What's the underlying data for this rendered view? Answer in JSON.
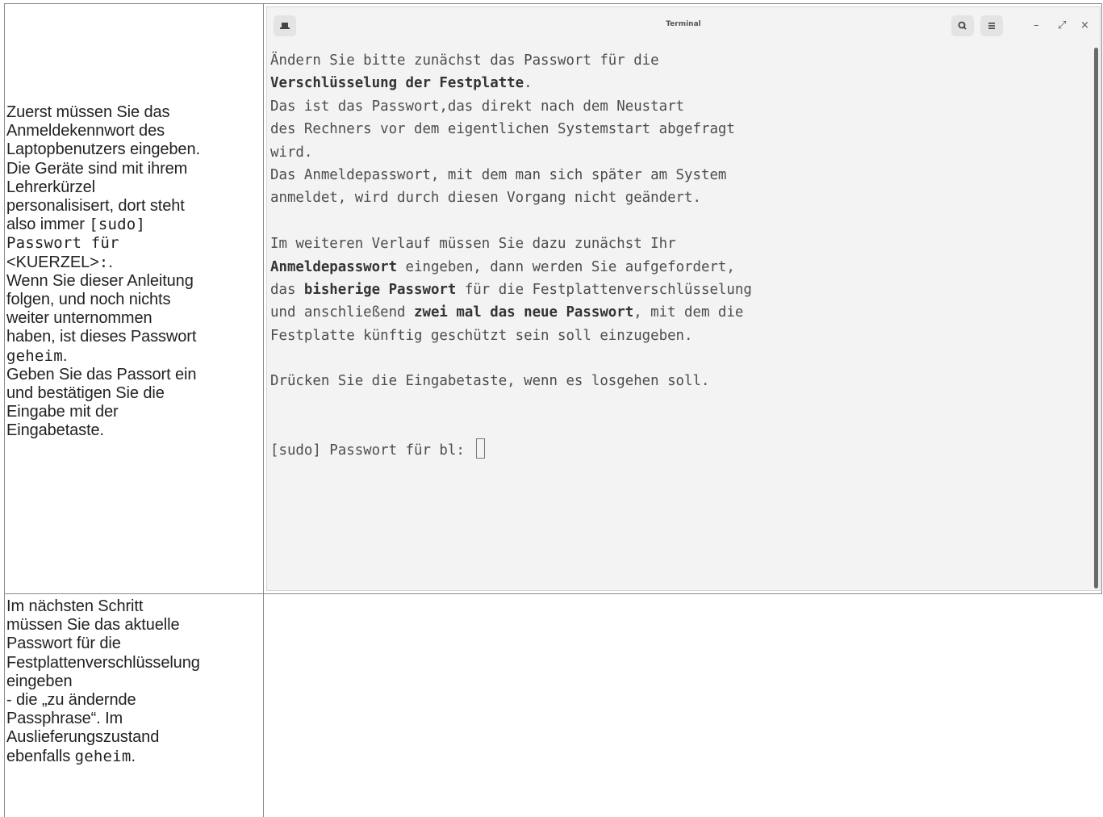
{
  "left_column": {
    "row1_lines": [
      {
        "text": "Zuerst müssen Sie das"
      },
      {
        "text": "Anmeldekennwort des"
      },
      {
        "text": "Laptopbenutzers eingeben."
      },
      {
        "text": "Die Geräte sind mit ihrem"
      },
      {
        "text": "Lehrerkürzel"
      },
      {
        "text": "personalisisert, dort steht"
      },
      {
        "pre": "also immer ",
        "code": "[sudo]"
      },
      {
        "code": "Passwort für"
      },
      {
        "pre": "<KUERZEL>",
        "code": ":",
        "post": "."
      },
      {
        "text": "Wenn Sie dieser Anleitung"
      },
      {
        "text": "folgen, und noch nichts"
      },
      {
        "text": "weiter unternommen"
      },
      {
        "text": "haben, ist dieses Passwort"
      },
      {
        "code": "geheim",
        "post": "."
      },
      {
        "text": "Geben Sie das Passort ein"
      },
      {
        "text": "und bestätigen Sie die"
      },
      {
        "text": "Eingabe mit der"
      },
      {
        "text": "Eingabetaste."
      }
    ],
    "row2_lines": [
      {
        "text": "Im nächsten Schritt"
      },
      {
        "text": "müssen Sie das aktuelle"
      },
      {
        "text": "Passwort für die"
      },
      {
        "text": "Festplattenverschlüsselung"
      },
      {
        "text": "eingeben"
      },
      {
        "text": "- die „zu ändernde"
      },
      {
        "text": "Passphrase“. Im"
      },
      {
        "text": "Auslieferungszustand"
      },
      {
        "pre": "ebenfalls ",
        "code": "geheim",
        "post": "."
      }
    ]
  },
  "terminal": {
    "title": "Terminal",
    "icons": {
      "new_tab": "new-tab-icon",
      "search": "search-icon",
      "menu": "menu-icon",
      "minimize": "minimize-icon",
      "maximize": "maximize-icon",
      "close": "close-icon"
    },
    "glyphs": {
      "minimize": "–",
      "maximize": "⤢",
      "close": "×"
    },
    "lines": [
      [
        {
          "t": "Ändern Sie bitte zunächst das Passwort für die"
        }
      ],
      [
        {
          "t": "Verschlüsselung der Festplatte",
          "b": true
        },
        {
          "t": "."
        }
      ],
      [
        {
          "t": "Das ist das Passwort,das direkt nach dem Neustart"
        }
      ],
      [
        {
          "t": "des Rechners vor dem eigentlichen Systemstart abgefragt"
        }
      ],
      [
        {
          "t": "wird."
        }
      ],
      [
        {
          "t": "Das Anmeldepasswort, mit dem man sich später am System"
        }
      ],
      [
        {
          "t": "anmeldet, wird durch diesen Vorgang nicht geändert."
        }
      ],
      [
        {
          "t": ""
        }
      ],
      [
        {
          "t": "Im weiteren Verlauf müssen Sie dazu zunächst Ihr"
        }
      ],
      [
        {
          "t": "Anmeldepasswort",
          "b": true
        },
        {
          "t": " eingeben, dann werden Sie aufgefordert,"
        }
      ],
      [
        {
          "t": "das "
        },
        {
          "t": "bisherige Passwort",
          "b": true
        },
        {
          "t": " für die Festplattenverschlüsselung"
        }
      ],
      [
        {
          "t": "und anschließend "
        },
        {
          "t": "zwei mal das neue Passwort",
          "b": true
        },
        {
          "t": ", mit dem die"
        }
      ],
      [
        {
          "t": "Festplatte künftig geschützt sein soll einzugeben."
        }
      ],
      [
        {
          "t": ""
        }
      ],
      [
        {
          "t": "Drücken Sie die Eingabetaste, wenn es losgehen soll."
        }
      ],
      [
        {
          "t": ""
        }
      ],
      [
        {
          "t": ""
        }
      ],
      [
        {
          "t": "[sudo] Passwort für bl: ",
          "cursor": true
        }
      ]
    ]
  }
}
